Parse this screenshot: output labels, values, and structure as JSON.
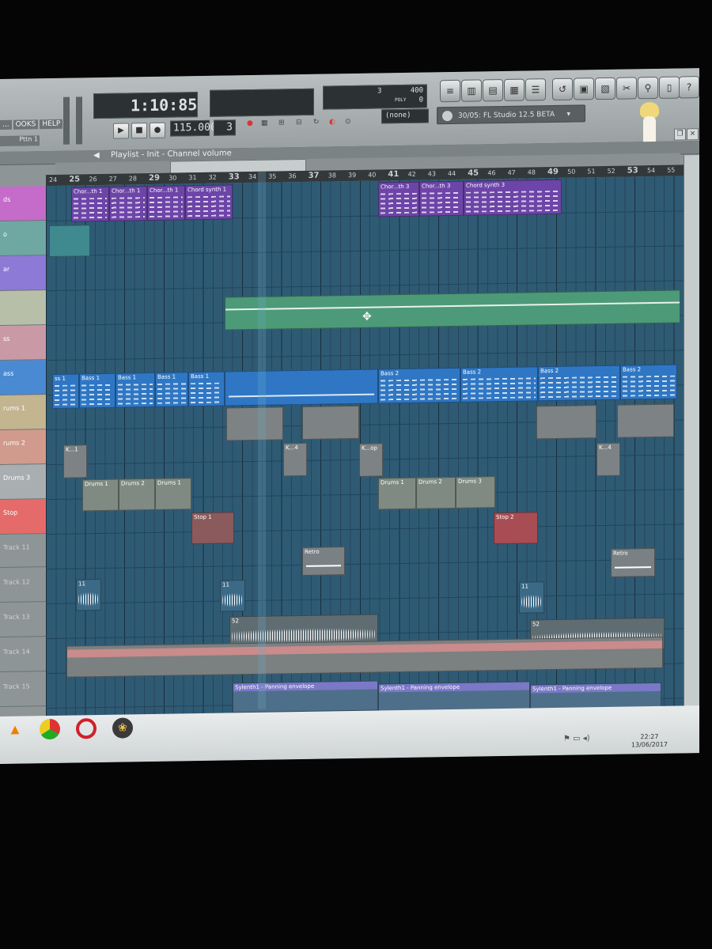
{
  "app": {
    "menu": [
      "...",
      "OOKS",
      "HELP"
    ],
    "pattern_selector": "Pttn 1",
    "song_time": "1:10:85",
    "tempo": "115.000",
    "pattern_num": "3",
    "snap": "(none)",
    "hint_text": "30/05: FL Studio 12.5 BETA",
    "cpu_value": "400",
    "poly_label": "POLY",
    "poly_value": "0",
    "mem_value": "3",
    "playlist_title": "Playlist - Init - Channel volume",
    "toolbar_icons": [
      "playlist-icon",
      "piano-roll-icon",
      "browser-icon",
      "mixer-icon",
      "channel-rack-icon",
      "undo-icon",
      "save-icon",
      "render-icon",
      "cut-icon",
      "zoom-icon",
      "info-icon",
      "help-icon"
    ]
  },
  "ruler": {
    "bars": [
      "24",
      "25",
      "26",
      "27",
      "28",
      "29",
      "30",
      "31",
      "32",
      "33",
      "34",
      "35",
      "36",
      "37",
      "38",
      "39",
      "40",
      "41",
      "42",
      "43",
      "44",
      "45",
      "46",
      "47",
      "48",
      "49",
      "50",
      "51",
      "52",
      "53",
      "54",
      "55"
    ],
    "emphasized": [
      "25",
      "29",
      "33",
      "37",
      "41",
      "45",
      "49",
      "53"
    ]
  },
  "tracks": [
    {
      "label": "ds",
      "color": "#c56bc9"
    },
    {
      "label": "o",
      "color": "#6fa7a3"
    },
    {
      "label": "ar",
      "color": "#8c7ad6"
    },
    {
      "label": "",
      "color": "#b7bfa8"
    },
    {
      "label": "ss",
      "color": "#c99aa6"
    },
    {
      "label": "ass",
      "color": "#4a8ad2"
    },
    {
      "label": "rums 1",
      "color": "#c2b58f"
    },
    {
      "label": "rums 2",
      "color": "#d09a8c"
    },
    {
      "label": "Drums 3",
      "color": "#a9aeb0"
    },
    {
      "label": "Stop",
      "color": "#e56b6b"
    },
    {
      "label": "Track 11",
      "color": "#8e9597"
    },
    {
      "label": "Track 12",
      "color": "#8e9597"
    },
    {
      "label": "Track 13",
      "color": "#8e9597"
    },
    {
      "label": "Track 14",
      "color": "#8e9597"
    },
    {
      "label": "Track 15",
      "color": "#8e9597"
    }
  ],
  "clips": {
    "chord_a1": "Chor...th 1",
    "chord_a2": "Chor...th 1",
    "chord_a3": "Chor...th 1",
    "chord_a4": "Chord synth 1",
    "chord_b1": "Chor...th 3",
    "chord_b2": "Chor...th 3",
    "chord_b3": "Chord synth 3",
    "bass1_a": "ss 1",
    "bass1_b": "Bass 1",
    "bass1_c": "Bass 1",
    "bass1_d": "Bass 1",
    "bass1_e": "Bass 1",
    "bass2_a": "Bass 2",
    "bass2_b": "Bass 2",
    "bass2_c": "Bass 2",
    "bass2_d": "Bass 2",
    "k1": "K...1",
    "k4a": "K...4",
    "kop": "K...op",
    "k4b": "K...4",
    "drums_a1": "Drums 1",
    "drums_a2": "Drums 2",
    "drums_a3": "Drums 1",
    "drums_b1": "Drums 1",
    "drums_b2": "Drums 2",
    "drums_b3": "Drums 3",
    "stop1": "Stop 1",
    "stop2": "Stop 2",
    "retro1": "Retro",
    "retro2": "Retro",
    "s11a": "11",
    "s11b": "11",
    "s11c": "11",
    "s52": "52",
    "env1": "Sylenth1 - Panning envelope",
    "env2": "Sylenth1 - Panning envelope",
    "env3": "Sylenth1 - Panning envelope"
  },
  "taskbar": {
    "clock_time": "22:27",
    "clock_date": "13/06/2017",
    "apps": [
      "vlc-icon",
      "chrome-icon",
      "opera-icon",
      "fl-studio-icon"
    ]
  },
  "colors": {
    "grid": "#2f5a74",
    "chord": "#7a4bb5",
    "bass": "#2f77c4",
    "pink": "#c98b8b",
    "env": "#7b78c7"
  }
}
